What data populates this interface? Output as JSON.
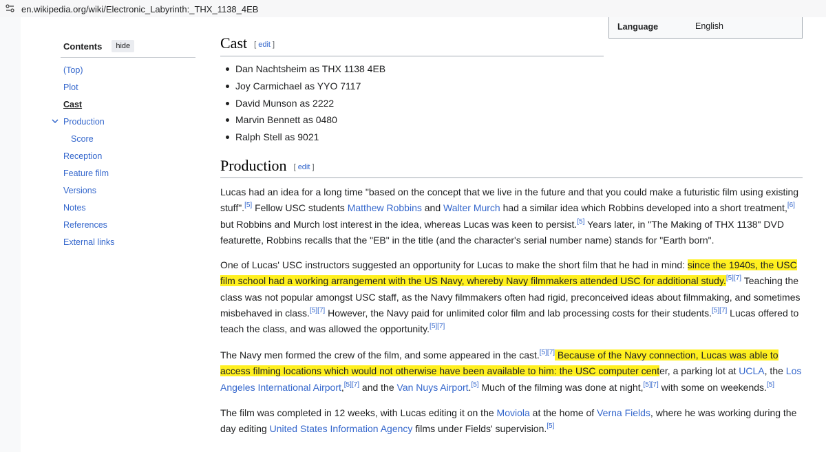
{
  "browser": {
    "url": "en.wikipedia.org/wiki/Electronic_Labyrinth:_THX_1138_4EB"
  },
  "infobox": {
    "label": "Language",
    "value": "English"
  },
  "toc": {
    "title": "Contents",
    "hide_label": "hide",
    "items": [
      {
        "label": "(Top)"
      },
      {
        "label": "Plot"
      },
      {
        "label": "Cast"
      },
      {
        "label": "Production"
      },
      {
        "label": "Score"
      },
      {
        "label": "Reception"
      },
      {
        "label": "Feature film"
      },
      {
        "label": "Versions"
      },
      {
        "label": "Notes"
      },
      {
        "label": "References"
      },
      {
        "label": "External links"
      }
    ]
  },
  "sections": {
    "edit_label": "edit",
    "cast": {
      "heading": "Cast",
      "items": [
        "Dan Nachtsheim as THX 1138 4EB",
        "Joy Carmichael as YYO 7117",
        "David Munson as 2222",
        "Marvin Bennett as 0480",
        "Ralph Stell as 9021"
      ]
    },
    "production": {
      "heading": "Production",
      "p1": {
        "t1": "Lucas had an idea for a long time \"based on the concept that we live in the future and that you could make a futuristic film using existing stuff\".",
        "r1": "[5]",
        "t2": " Fellow USC students ",
        "l1": "Matthew Robbins",
        "t3": " and ",
        "l2": "Walter Murch",
        "t4": " had a similar idea which Robbins developed into a short treatment,",
        "r2": "[6]",
        "t5": " but Robbins and Murch lost interest in the idea, whereas Lucas was keen to persist.",
        "r3": "[5]",
        "t6": " Years later, in \"The Making of THX 1138\" DVD featurette, Robbins recalls that the \"EB\" in the title (and the character's serial number name) stands for \"Earth born\"."
      },
      "p2": {
        "t1": "One of Lucas' USC instructors suggested an opportunity for Lucas to make the short film that he had in mind: ",
        "h1": "since the 1940s, the USC film school had a working arrangement with the US Navy, whereby Navy filmmakers attended USC for additional study.",
        "r1": "[5]",
        "r2": "[7]",
        "t2": " Teaching the class was not popular amongst USC staff, as the Navy filmmakers often had rigid, preconceived ideas about filmmaking, and sometimes misbehaved in class.",
        "r3": "[5]",
        "r4": "[7]",
        "t3": " However, the Navy paid for unlimited color film and lab processing costs for their students.",
        "r5": "[5]",
        "r6": "[7]",
        "t4": " Lucas offered to teach the class, and was allowed the opportunity.",
        "r7": "[5]",
        "r8": "[7]"
      },
      "p3": {
        "t1": "The Navy men formed the crew of the film, and some appeared in the cast.",
        "r1": "[5]",
        "r2": "[7]",
        "h1": " Because of the Navy connection, Lucas was able to access filming locations which would not otherwise have been available to him: the USC computer cent",
        "t2": "er, a parking lot at ",
        "l1": "UCLA",
        "t3": ", the ",
        "l2": "Los Angeles International Airport",
        "t4": ",",
        "r3": "[5]",
        "r4": "[7]",
        "t5": " and the ",
        "l3": "Van Nuys Airport",
        "t6": ".",
        "r5": "[5]",
        "t7": " Much of the filming was done at night,",
        "r6": "[5]",
        "r7": "[7]",
        "t8": " with some on weekends.",
        "r8": "[5]"
      },
      "p4": {
        "t1": "The film was completed in 12 weeks, with Lucas editing it on the ",
        "l1": "Moviola",
        "t2": " at the home of ",
        "l2": "Verna Fields",
        "t3": ", where he was working during the day editing ",
        "l3": "United States Information Agency",
        "t4": " films under Fields' supervision.",
        "r1": "[5]"
      }
    }
  },
  "colors": {
    "link": "#3366cc",
    "highlight": "#fff020",
    "text": "#202122"
  }
}
